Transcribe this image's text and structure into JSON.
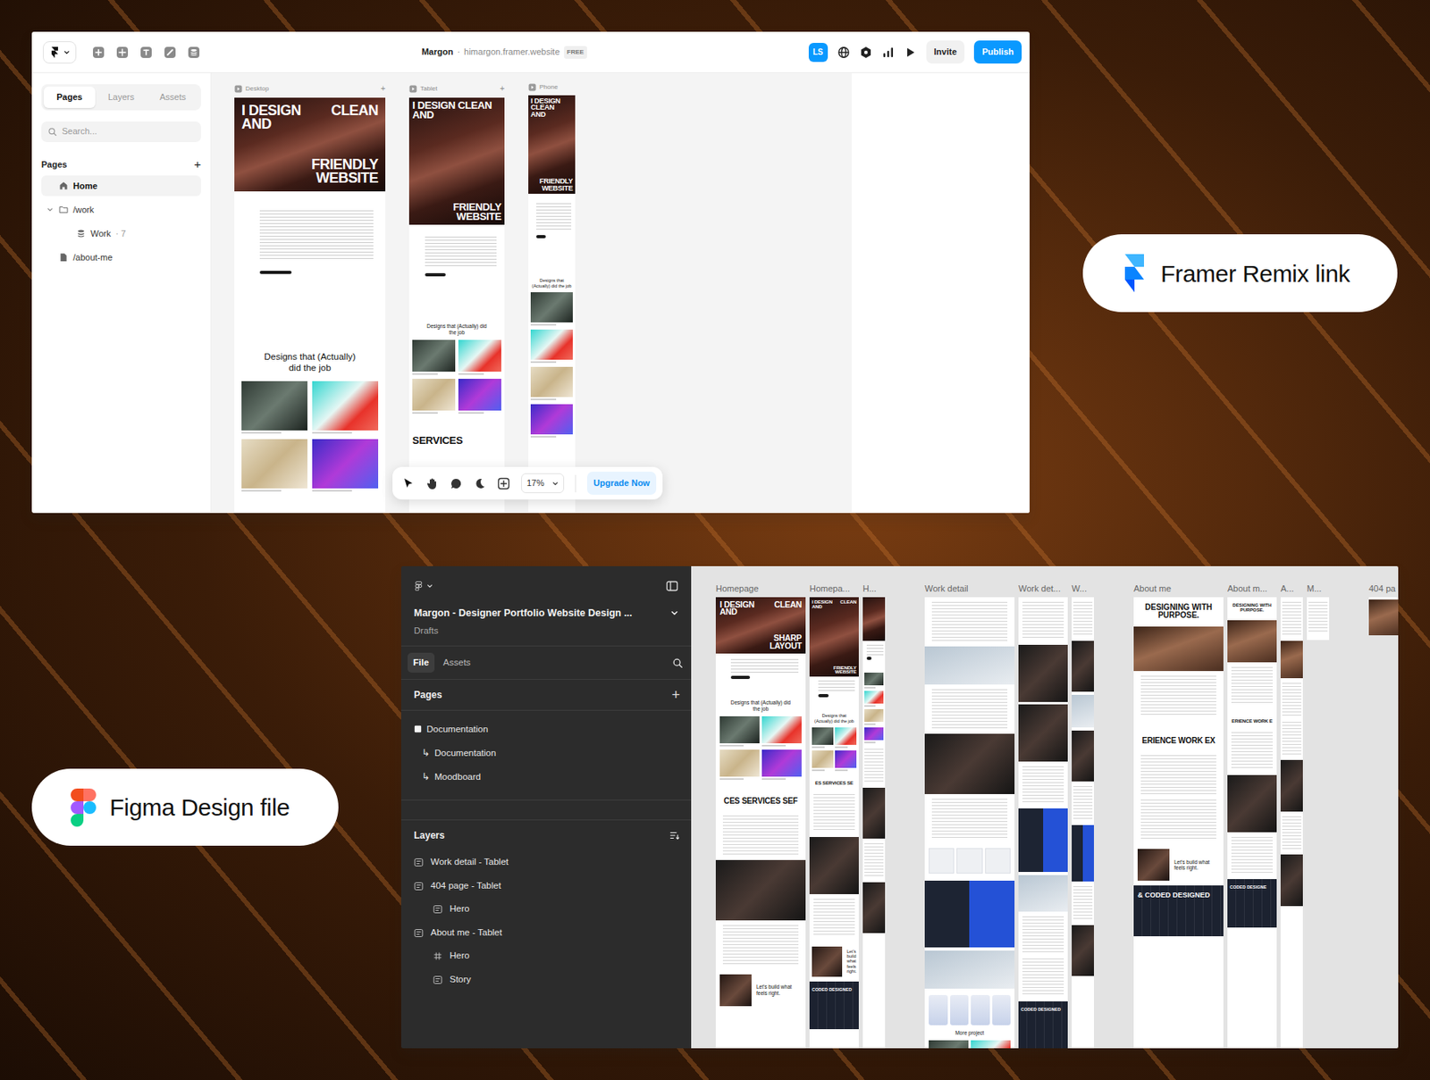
{
  "framer": {
    "toolbar": {
      "project": "Margon",
      "separator": "·",
      "url": "himargon.framer.website",
      "plan": "FREE",
      "avatar": "LS",
      "invite": "Invite",
      "publish": "Publish"
    },
    "sidebar": {
      "tabs": [
        {
          "label": "Pages",
          "selected": true
        },
        {
          "label": "Layers",
          "selected": false
        },
        {
          "label": "Assets",
          "selected": false
        }
      ],
      "search": {
        "placeholder": "Search..."
      },
      "heading": "Pages",
      "add": "+",
      "items": [
        {
          "label": "Home",
          "kind": "home",
          "selected": true
        },
        {
          "label": "/work",
          "kind": "folder",
          "selected": false,
          "expanded": true
        },
        {
          "label": "Work",
          "meta": "· 7",
          "kind": "cms",
          "selected": false
        },
        {
          "label": "/about-me",
          "kind": "page",
          "selected": false
        }
      ]
    },
    "frames": [
      {
        "label": "Desktop",
        "add": "+",
        "kind": "desktop",
        "blocks": [
          {
            "kind": "hero",
            "top": [
              [
                "I DESIGN",
                "CLEAN"
              ],
              [
                "AND"
              ]
            ],
            "bottom": [
              "FRIENDLY",
              "WEBSITE"
            ]
          },
          {
            "kind": "intro"
          },
          {
            "kind": "title",
            "text": "Designs that (Actually) did the job"
          },
          {
            "kind": "photos"
          }
        ]
      },
      {
        "label": "Tablet",
        "add": "+",
        "kind": "tablet",
        "blocks": [
          {
            "kind": "hero",
            "top": [
              [
                "I DESIGN CLEAN"
              ],
              [
                "AND"
              ]
            ],
            "bottom": [
              "FRIENDLY",
              "WEBSITE"
            ]
          },
          {
            "kind": "intro"
          },
          {
            "kind": "title",
            "text": "Designs that (Actually) did the job"
          },
          {
            "kind": "photos"
          },
          {
            "kind": "marquee",
            "text": "SERVICES"
          }
        ]
      },
      {
        "label": "Phone",
        "kind": "phone",
        "blocks": [
          {
            "kind": "hero",
            "top": [
              [
                "I DESIGN"
              ],
              [
                "CLEAN"
              ],
              [
                "AND"
              ]
            ],
            "bottom": [
              "FRIENDLY",
              "WEBSITE"
            ]
          },
          {
            "kind": "intro"
          },
          {
            "kind": "title",
            "text": "Designs that (Actually) did the job"
          },
          {
            "kind": "photos"
          }
        ]
      }
    ],
    "canvas_toolbar": {
      "zoom": "17%",
      "upgrade": "Upgrade Now"
    }
  },
  "framer_label": {
    "text": "Framer Remix link"
  },
  "figma": {
    "header": {
      "title": "Margon - Designer Portfolio Website Design ...",
      "subtitle": "Drafts"
    },
    "tabs": [
      {
        "label": "File",
        "selected": true
      },
      {
        "label": "Assets",
        "selected": false
      }
    ],
    "pages": {
      "heading": "Pages",
      "add": "+",
      "items": [
        {
          "label": "Documentation",
          "kind": "page"
        },
        {
          "label": "Documentation",
          "kind": "sub",
          "prefix": "↳"
        },
        {
          "label": "Moodboard",
          "kind": "sub",
          "prefix": "↳"
        }
      ]
    },
    "layers": {
      "heading": "Layers",
      "items": [
        {
          "label": "Work detail - Tablet",
          "kind": "autolayout",
          "nested": false
        },
        {
          "label": "404 page - Tablet",
          "kind": "autolayout",
          "nested": false
        },
        {
          "label": "Hero",
          "kind": "autolayout",
          "nested": true
        },
        {
          "label": "About me - Tablet",
          "kind": "autolayout",
          "nested": false
        },
        {
          "label": "Hero",
          "kind": "frame",
          "nested": true
        },
        {
          "label": "Story",
          "kind": "autolayout",
          "nested": true
        }
      ]
    },
    "canvas": {
      "groups": [
        {
          "frames": [
            {
              "label": "Homepage",
              "kind": "desktop",
              "blocks": [
                {
                  "kind": "hero",
                  "top": [
                    [
                      "I DESIGN",
                      "CLEAN"
                    ],
                    [
                      "AND"
                    ]
                  ],
                  "bottom": [
                    "SHARP",
                    "LAYOUT"
                  ]
                },
                {
                  "kind": "intro"
                },
                {
                  "kind": "title",
                  "text": "Designs that (Actually) did the job"
                },
                {
                  "kind": "photos"
                },
                {
                  "kind": "marquee",
                  "text": "CES SERVICES SEF"
                },
                {
                  "kind": "list"
                },
                {
                  "kind": "photo-dark"
                },
                {
                  "kind": "list"
                },
                {
                  "kind": "cta",
                  "text": "Let's build what feels right."
                }
              ]
            },
            {
              "label": "Homepa...",
              "kind": "tablet",
              "blocks": [
                {
                  "kind": "hero",
                  "top": [
                    [
                      "I DESIGN",
                      "CLEAN"
                    ],
                    [
                      "AND"
                    ]
                  ],
                  "bottom": [
                    "FRIENDLY",
                    "WEBSITE"
                  ]
                },
                {
                  "kind": "intro"
                },
                {
                  "kind": "title",
                  "text": "Designs that (Actually) did the job"
                },
                {
                  "kind": "photos"
                },
                {
                  "kind": "marquee",
                  "text": "ES SERVICES SE"
                },
                {
                  "kind": "list"
                },
                {
                  "kind": "photo-dark"
                },
                {
                  "kind": "list"
                },
                {
                  "kind": "cta",
                  "text": "Let's build what feels right."
                },
                {
                  "kind": "footer",
                  "text": "CODED DESIGNED"
                }
              ]
            },
            {
              "label": "H...",
              "kind": "phone",
              "blocks": [
                {
                  "kind": "hero"
                },
                {
                  "kind": "intro"
                },
                {
                  "kind": "photos"
                },
                {
                  "kind": "list"
                },
                {
                  "kind": "photo-dark"
                },
                {
                  "kind": "list"
                },
                {
                  "kind": "photo-dark"
                }
              ]
            }
          ]
        },
        {
          "frames": [
            {
              "label": "Work detail",
              "kind": "desktop",
              "blocks": [
                {
                  "kind": "list"
                },
                {
                  "kind": "photo-light"
                },
                {
                  "kind": "list"
                },
                {
                  "kind": "photo-dark"
                },
                {
                  "kind": "list"
                },
                {
                  "kind": "cards"
                },
                {
                  "kind": "photo-blue"
                },
                {
                  "kind": "photo-light"
                },
                {
                  "kind": "phones"
                },
                {
                  "kind": "title",
                  "text": "More project"
                },
                {
                  "kind": "photos"
                }
              ]
            },
            {
              "label": "Work det...",
              "kind": "tablet",
              "blocks": [
                {
                  "kind": "list"
                },
                {
                  "kind": "photo-dark"
                },
                {
                  "kind": "photo-dark"
                },
                {
                  "kind": "list"
                },
                {
                  "kind": "photo-blue"
                },
                {
                  "kind": "photo-light"
                },
                {
                  "kind": "list"
                },
                {
                  "kind": "list"
                },
                {
                  "kind": "footer",
                  "text": "CODED DESIGNED"
                }
              ]
            },
            {
              "label": "W...",
              "kind": "phone",
              "blocks": [
                {
                  "kind": "list"
                },
                {
                  "kind": "photo-dark"
                },
                {
                  "kind": "photo-light"
                },
                {
                  "kind": "photo-dark"
                },
                {
                  "kind": "list"
                },
                {
                  "kind": "photo-blue"
                },
                {
                  "kind": "list"
                },
                {
                  "kind": "photo-dark"
                }
              ]
            }
          ]
        },
        {
          "frames": [
            {
              "label": "About me",
              "kind": "desktop",
              "blocks": [
                {
                  "kind": "heading",
                  "text": "DESIGNING WITH PURPOSE."
                },
                {
                  "kind": "photo-warm"
                },
                {
                  "kind": "list"
                },
                {
                  "kind": "marquee",
                  "text": "ERIENCE WORK EX"
                },
                {
                  "kind": "list"
                },
                {
                  "kind": "list"
                },
                {
                  "kind": "cta",
                  "text": "Let's build what feels right."
                },
                {
                  "kind": "footer",
                  "text": "& CODED DESIGNED"
                }
              ]
            },
            {
              "label": "About m...",
              "kind": "tablet",
              "blocks": [
                {
                  "kind": "heading",
                  "text": "DESIGNING WITH PURPOSE."
                },
                {
                  "kind": "photo-warm"
                },
                {
                  "kind": "list"
                },
                {
                  "kind": "marquee",
                  "text": "ERIENCE WORK E"
                },
                {
                  "kind": "list"
                },
                {
                  "kind": "photo-dark"
                },
                {
                  "kind": "list"
                },
                {
                  "kind": "footer",
                  "text": "CODED DESIGNE"
                }
              ]
            },
            {
              "label": "A...",
              "kind": "phone",
              "blocks": [
                {
                  "kind": "list"
                },
                {
                  "kind": "photo-warm"
                },
                {
                  "kind": "list"
                },
                {
                  "kind": "list"
                },
                {
                  "kind": "photo-dark"
                },
                {
                  "kind": "list"
                },
                {
                  "kind": "photo-dark"
                }
              ]
            },
            {
              "label": "M...",
              "kind": "mini",
              "blocks": [
                {
                  "kind": "list"
                }
              ]
            }
          ]
        },
        {
          "frames": [
            {
              "label": "404 pa",
              "kind": "stub",
              "blocks": [
                {
                  "kind": "photo-warm"
                }
              ]
            }
          ]
        }
      ]
    }
  },
  "figma_label": {
    "text": "Figma Design file"
  }
}
